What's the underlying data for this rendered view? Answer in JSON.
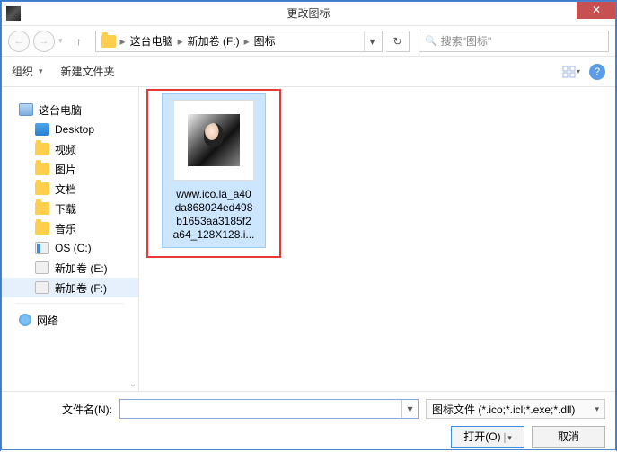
{
  "title": "更改图标",
  "nav": {
    "crumbs": [
      "这台电脑",
      "新加卷 (F:)",
      "图标"
    ],
    "search_placeholder": "搜索\"图标\""
  },
  "toolbar": {
    "organize": "组织",
    "new_folder": "新建文件夹"
  },
  "tree": {
    "this_pc": "这台电脑",
    "desktop": "Desktop",
    "video": "视频",
    "pictures": "图片",
    "documents": "文档",
    "downloads": "下载",
    "music": "音乐",
    "os_c": "OS (C:)",
    "vol_e": "新加卷 (E:)",
    "vol_f": "新加卷 (F:)",
    "network": "网络"
  },
  "file": {
    "line1": "www.ico.la_a40",
    "line2": "da868024ed498",
    "line3": "b1653aa3185f2",
    "line4": "a64_128X128.i..."
  },
  "footer": {
    "filename_label": "文件名(N):",
    "filename_value": "",
    "filter": "图标文件 (*.ico;*.icl;*.exe;*.dll)",
    "open": "打开(O)",
    "cancel": "取消"
  }
}
